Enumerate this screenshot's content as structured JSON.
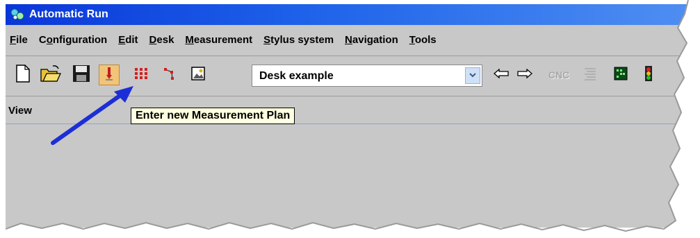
{
  "window": {
    "title": "Automatic Run",
    "app_icon": "app-icon"
  },
  "menu": {
    "items": [
      {
        "mnemonic": "F",
        "rest": "ile"
      },
      {
        "pre": "C",
        "mnemonic": "o",
        "rest": "nfiguration"
      },
      {
        "mnemonic": "E",
        "rest": "dit"
      },
      {
        "mnemonic": "D",
        "rest": "esk"
      },
      {
        "mnemonic": "M",
        "rest": "easurement"
      },
      {
        "mnemonic": "S",
        "rest": "tylus system"
      },
      {
        "mnemonic": "N",
        "rest": "avigation"
      },
      {
        "mnemonic": "T",
        "rest": "ools"
      }
    ]
  },
  "toolbar": {
    "buttons": [
      {
        "icon": "new-document-icon"
      },
      {
        "icon": "open-folder-icon"
      },
      {
        "icon": "save-disk-icon"
      },
      {
        "icon": "measurement-plan-icon",
        "active": true
      },
      {
        "icon": "grid-dots-icon"
      },
      {
        "icon": "path-icon"
      },
      {
        "icon": "picture-icon"
      }
    ],
    "desk_select": {
      "value": "Desk example"
    },
    "right_buttons": [
      {
        "icon": "arrow-left-icon"
      },
      {
        "icon": "arrow-right-icon"
      },
      {
        "icon": "cnc-icon",
        "label": "CNC",
        "disabled": true
      },
      {
        "icon": "list-icon",
        "disabled": true
      },
      {
        "icon": "board-icon"
      },
      {
        "icon": "traffic-light-icon"
      }
    ]
  },
  "view": {
    "label": "View"
  },
  "tooltip": {
    "text": "Enter new Measurement Plan"
  },
  "colors": {
    "titlebar": "#0a36d8",
    "window_bg": "#c8c8c8",
    "tooltip_bg": "#ffffe1",
    "annotation_arrow": "#1c2fd6"
  }
}
